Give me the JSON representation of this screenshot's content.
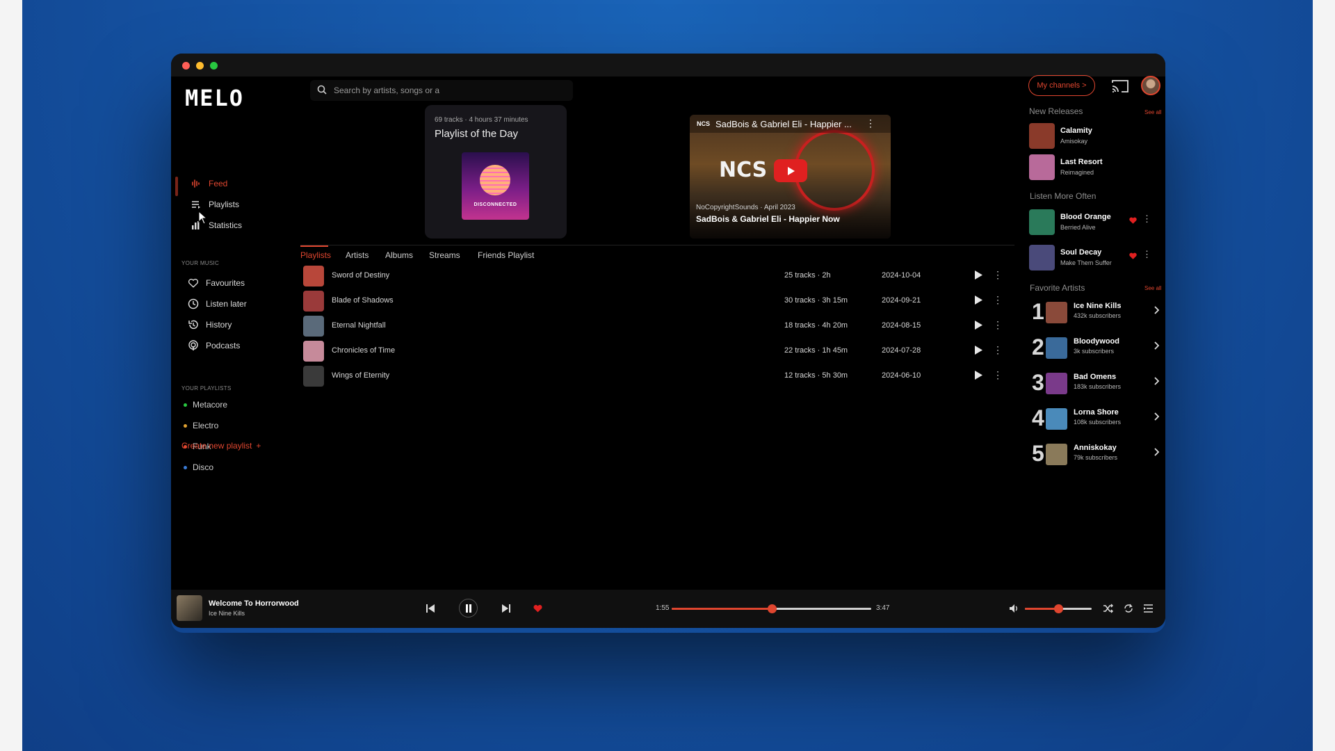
{
  "sidebar": {
    "logo": "MELO",
    "nav": [
      {
        "label": "Feed",
        "icon": "feed-icon"
      },
      {
        "label": "Playlists",
        "icon": "playlists-icon"
      },
      {
        "label": "Statistics",
        "icon": "statistics-icon"
      }
    ],
    "your_music_label": "YOUR MUSIC",
    "music": [
      {
        "label": "Favourites",
        "icon": "heart-icon"
      },
      {
        "label": "Listen later",
        "icon": "clock-icon"
      },
      {
        "label": "History",
        "icon": "history-icon"
      },
      {
        "label": "Podcasts",
        "icon": "podcast-icon"
      }
    ],
    "your_playlists_label": "YOUR PLAYLISTS",
    "playlists": [
      {
        "label": "Metacore",
        "color": "#28c840"
      },
      {
        "label": "Electro",
        "color": "#e0a030"
      },
      {
        "label": "Funk",
        "color": "#e0462f"
      },
      {
        "label": "Disco",
        "color": "#3a7bd5"
      }
    ],
    "create_playlist": "Create new playlist",
    "create_plus": "+"
  },
  "search": {
    "placeholder": "Search by artists, songs or a"
  },
  "header": {
    "channels_button": "My channels >"
  },
  "playlist_of_day": {
    "meta": "69 tracks · 4 hours 37 minutes",
    "title": "Playlist of the Day",
    "album_text": "DISCONNECTED"
  },
  "video": {
    "tag": "NCS",
    "head_title": "SadBois & Gabriel Eli - Happier ...",
    "logo_text": "NCS",
    "channel": "NoCopyrightSounds · April 2023",
    "title": "SadBois & Gabriel Eli - Happier Now"
  },
  "tabs": [
    "Playlists",
    "Artists",
    "Albums",
    "Streams",
    "Friends Playlist"
  ],
  "rows": [
    {
      "name": "Sword of Destiny",
      "meta": "25 tracks · 2h",
      "date": "2024-10-04",
      "thumb": "#b8473a"
    },
    {
      "name": "Blade of Shadows",
      "meta": "30 tracks · 3h 15m",
      "date": "2024-09-21",
      "thumb": "#9a3a3a"
    },
    {
      "name": "Eternal Nightfall",
      "meta": "18 tracks · 4h 20m",
      "date": "2024-08-15",
      "thumb": "#5a6a7a"
    },
    {
      "name": "Chronicles of Time",
      "meta": "22 tracks · 1h 45m",
      "date": "2024-07-28",
      "thumb": "#c68a9a"
    },
    {
      "name": "Wings of Eternity",
      "meta": "12 tracks · 5h 30m",
      "date": "2024-06-10",
      "thumb": "#3a3a3a"
    }
  ],
  "right": {
    "new_releases_label": "New Releases",
    "see_all": "See all",
    "new_releases": [
      {
        "title": "Calamity",
        "sub": "Amisokay",
        "color": "#8a3a2a"
      },
      {
        "title": "Last Resort",
        "sub": "Reimagined",
        "color": "#b86a9a"
      }
    ],
    "listen_more_label": "Listen More Often",
    "listen_more": [
      {
        "title": "Blood Orange",
        "sub": "Berried Alive",
        "color": "#2a7a5a"
      },
      {
        "title": "Soul Decay",
        "sub": "Make Them Suffer",
        "color": "#4a4a7a"
      }
    ],
    "fav_artists_label": "Favorite Artists",
    "fav_artists": [
      {
        "rank": "1",
        "name": "Ice Nine Kills",
        "subs": "432k subscribers",
        "color": "#8a4a3a"
      },
      {
        "rank": "2",
        "name": "Bloodywood",
        "subs": "3k subscribers",
        "color": "#3a6a9a"
      },
      {
        "rank": "3",
        "name": "Bad Omens",
        "subs": "183k subscribers",
        "color": "#7a3a8a"
      },
      {
        "rank": "4",
        "name": "Lorna Shore",
        "subs": "108k subscribers",
        "color": "#4a8aba"
      },
      {
        "rank": "5",
        "name": "Anniskokay",
        "subs": "79k subscribers",
        "color": "#8a7a5a"
      }
    ]
  },
  "player": {
    "title": "Welcome To Horrorwood",
    "artist": "Ice Nine Kills",
    "current": "1:55",
    "total": "3:47",
    "progress": 0.5,
    "volume": 0.5
  },
  "colors": {
    "accent": "#e0462f"
  }
}
